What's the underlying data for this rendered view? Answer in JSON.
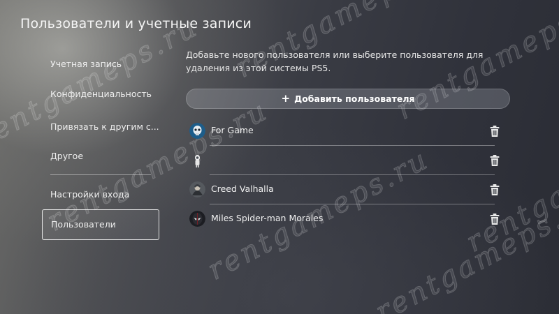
{
  "page": {
    "title": "Пользователи и учетные записи"
  },
  "sidebar": {
    "items": [
      {
        "label": "Учетная запись"
      },
      {
        "label": "Конфиденциальность"
      },
      {
        "label": "Привязать к другим с..."
      },
      {
        "label": "Другое"
      },
      {
        "label": "Настройки входа"
      },
      {
        "label": "Пользователи",
        "selected": true
      }
    ]
  },
  "main": {
    "description": "Добавьте нового пользователя или выберите пользователя для удаления из этой системы PS5.",
    "add_button": {
      "icon": "plus-icon",
      "label": "Добавить пользователя"
    },
    "users": [
      {
        "name": "For Game",
        "avatar": "skull-avatar",
        "action_icon": "trash-icon"
      },
      {
        "name": "",
        "avatar": "astronaut-avatar",
        "action_icon": "trash-icon"
      },
      {
        "name": "Creed Valhalla",
        "avatar": "warrior-avatar",
        "action_icon": "trash-icon"
      },
      {
        "name": "Miles Spider-man Morales",
        "avatar": "spiderman-avatar",
        "action_icon": "trash-icon"
      }
    ]
  },
  "watermark": {
    "text": "rentgameps.ru"
  }
}
